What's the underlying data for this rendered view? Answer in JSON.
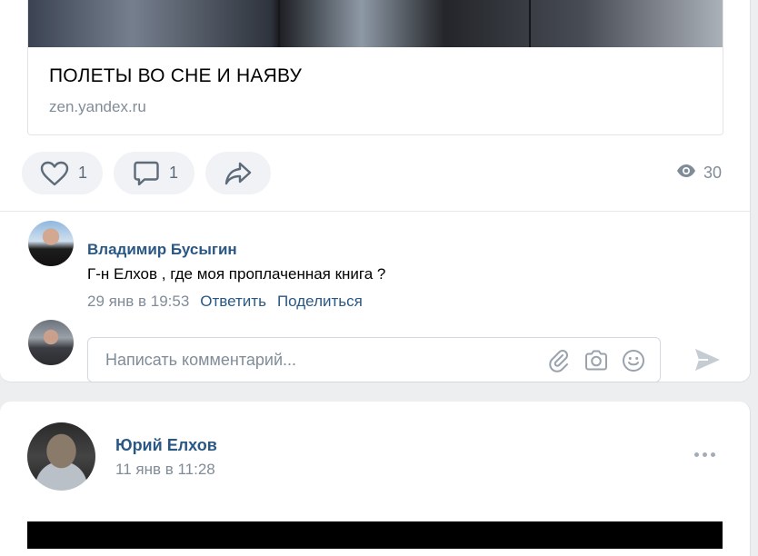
{
  "link_card": {
    "title": "ПОЛЕТЫ ВО СНЕ И НАЯВУ",
    "domain": "zen.yandex.ru"
  },
  "actions": {
    "likes": "1",
    "comments": "1",
    "views": "30",
    "icons": [
      "heart-icon",
      "comment-icon",
      "share-icon",
      "eye-icon"
    ]
  },
  "comment": {
    "author": "Владимир Бусыгин",
    "text": "Г-н Елхов , где моя проплаченная книга ?",
    "time": "29 янв в 19:53",
    "reply_label": "Ответить",
    "share_label": "Поделиться"
  },
  "comment_input": {
    "placeholder": "Написать комментарий...",
    "icons": [
      "paperclip-icon",
      "camera-icon",
      "smile-icon",
      "send-icon"
    ]
  },
  "post": {
    "author": "Юрий Елхов",
    "time": "11 янв в 11:28"
  },
  "colors": {
    "link": "#2a5885",
    "secondary_text": "#818c99",
    "pill_bg": "#f0f2f5",
    "page_bg": "#edeef0"
  }
}
